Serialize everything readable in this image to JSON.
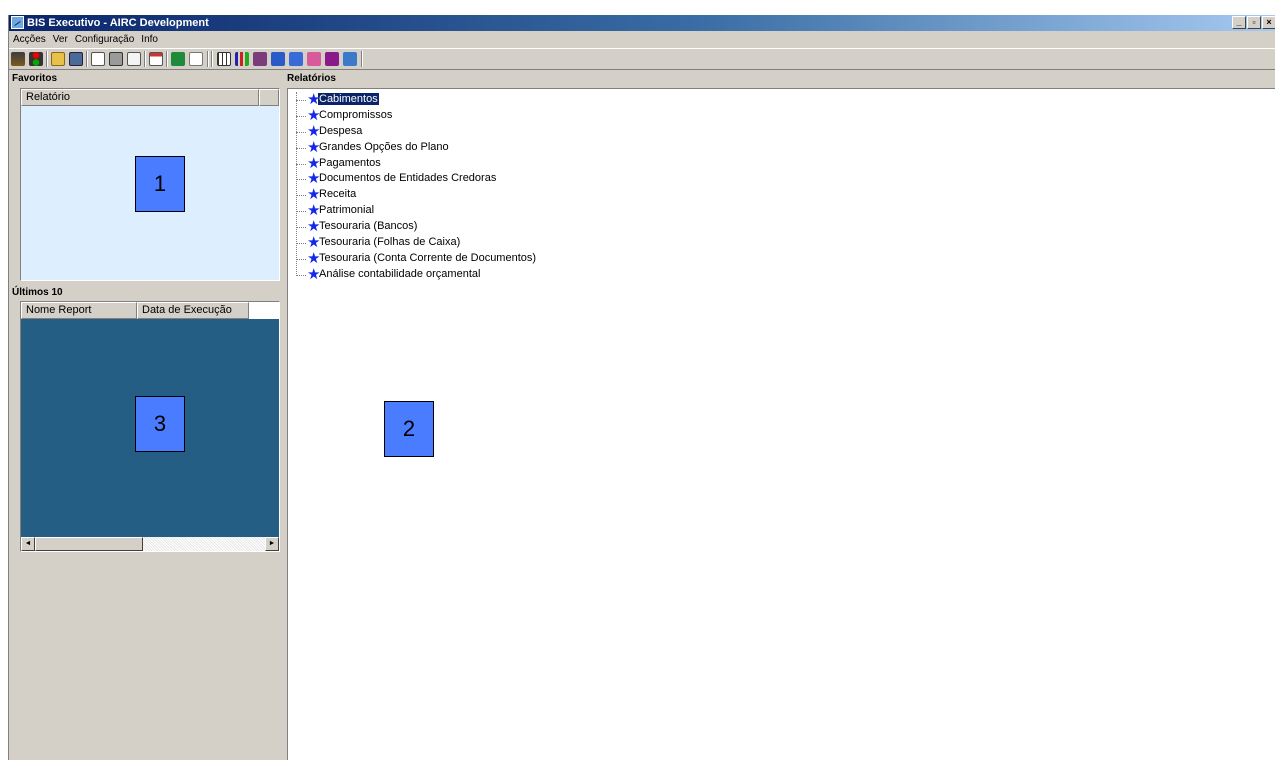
{
  "window": {
    "title": "BIS Executivo - AIRC Development",
    "controls": {
      "minimize": "_",
      "maximize": "▫",
      "close": "×"
    }
  },
  "menu": [
    "Acções",
    "Ver",
    "Configuração",
    "Info"
  ],
  "toolbar": {
    "icons": [
      "exit-icon",
      "traffic-light-icon",
      "open-folder-icon",
      "save-icon",
      "print-preview-icon",
      "print-icon",
      "page-setup-icon",
      "export-icon",
      "excel-icon",
      "edit-icon",
      "table-view-icon",
      "bar-chart-icon",
      "chart-icon",
      "chart-icon",
      "chart-icon",
      "chart-icon",
      "chart-icon",
      "chart-icon"
    ]
  },
  "favoritos": {
    "label": "Favoritos",
    "columns": [
      "Relatório",
      ""
    ],
    "badge": "1",
    "background": "#ddeeff"
  },
  "ultimos": {
    "label": "Últimos 10",
    "columns": [
      "Nome Report",
      "Data de Execução"
    ],
    "badge": "3",
    "background": "#255e85",
    "scroll_left": "◄",
    "scroll_right": "►"
  },
  "relatorios": {
    "label": "Relatórios",
    "badge": "2",
    "selected": "Cabimentos",
    "items": [
      "Cabimentos",
      "Compromissos",
      "Despesa",
      "Grandes Opções do Plano",
      "Pagamentos",
      "Documentos de Entidades Credoras",
      "Receita",
      "Patrimonial",
      "Tesouraria (Bancos)",
      "Tesouraria (Folhas de Caixa)",
      "Tesouraria (Conta Corrente de Documentos)",
      "Análise contabilidade orçamental"
    ],
    "item_icon": "★",
    "icon_color": "#1428e6"
  }
}
